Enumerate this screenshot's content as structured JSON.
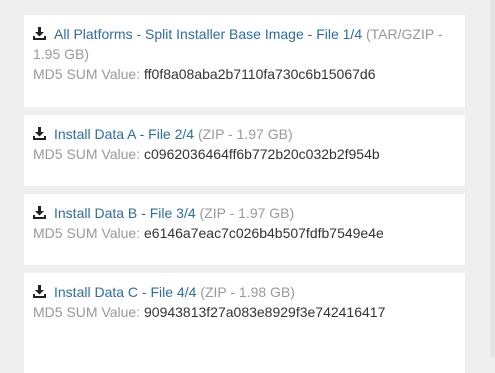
{
  "downloads": [
    {
      "title": "All Platforms - Split Installer Base Image - File 1/4",
      "meta": "(TAR/GZIP - 1.95 GB)",
      "md5_label": "MD5 SUM Value:",
      "md5_value": "ff0f8a08aba2b7110fa730c6b15067d6",
      "icon": "download-icon"
    },
    {
      "title": "Install Data A - File 2/4",
      "meta": "(ZIP - 1.97 GB)",
      "md5_label": "MD5 SUM Value:",
      "md5_value": "c0962036464ff6b772b20c032b2f954b",
      "icon": "download-icon"
    },
    {
      "title": "Install Data B - File 3/4",
      "meta": "(ZIP - 1.97 GB)",
      "md5_label": "MD5 SUM Value:",
      "md5_value": "e6146a7eac7c026b4b507fdfb7549e4e",
      "icon": "download-icon"
    },
    {
      "title": "Install Data C - File 4/4",
      "meta": "(ZIP - 1.98 GB)",
      "md5_label": "MD5 SUM Value:",
      "md5_value": "90943813f27a083e8929f3e742416417",
      "icon": "download-icon"
    }
  ],
  "colors": {
    "link": "#2e6da4",
    "muted": "#999999",
    "text": "#333333",
    "background": "#efefef",
    "card": "#ffffff"
  }
}
